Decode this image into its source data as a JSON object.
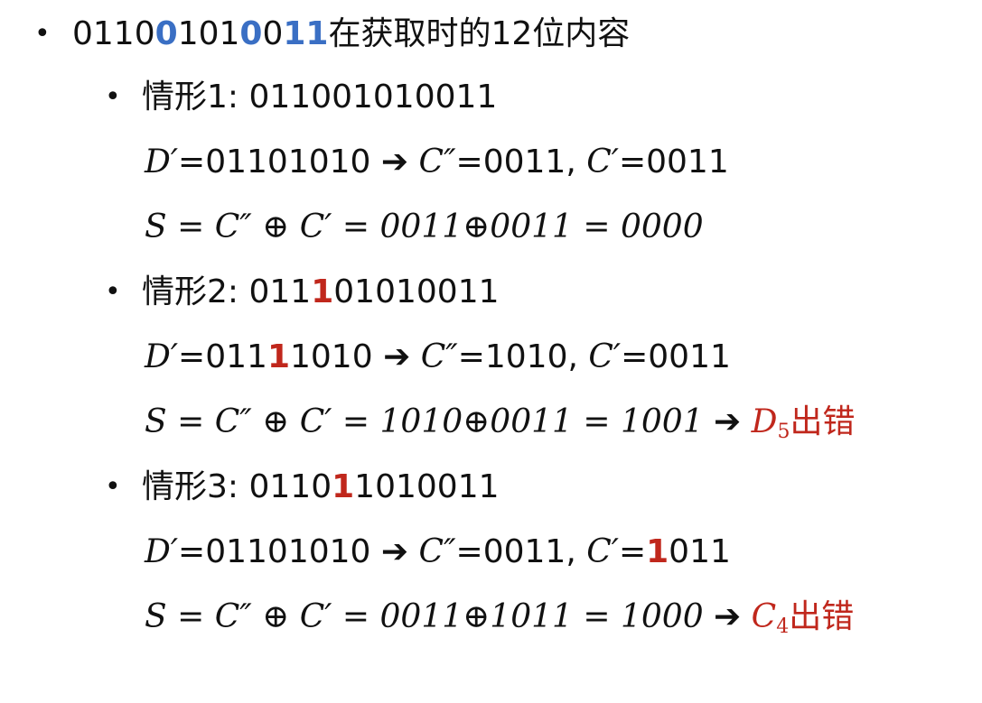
{
  "bullet_glyph": "•",
  "arrow_glyph": "➔",
  "header": {
    "p0": "0110",
    "h0": "0",
    "p1": "101",
    "h1": "0",
    "p2": "0",
    "h2": "11",
    "suffix": "在获取时的12位内容"
  },
  "cases": [
    {
      "title": "情形1: 011001010011",
      "d_label": "D′",
      "d_value": "=01101010",
      "c2_label": "C″",
      "c2_value": "=0011,",
      "c1_label": "C′",
      "c1_value": "=0011",
      "s_expr": "S = C″ ⊕ C′ = 0011⊕0011 = 0000"
    },
    {
      "title_a": "情形2: 011",
      "title_h": "1",
      "title_b": "01010011",
      "d_label": "D′",
      "d_a": "=011",
      "d_h": "1",
      "d_b": "1010",
      "c2_label": "C″",
      "c2_value": "=1010,",
      "c1_label": "C′",
      "c1_value": "=0011",
      "s_expr": "S = C″ ⊕ C′ = 1010⊕0011 = 1001",
      "result_var": "D",
      "result_sub": "5",
      "result_text": "出错"
    },
    {
      "title_a": "情形3: 0110",
      "title_h": "1",
      "title_b": "1010011",
      "d_label": "D′",
      "d_value": "=01101010",
      "c2_label": "C″",
      "c2_value": "=0011,",
      "c1_label": "C′",
      "c1_a": "=",
      "c1_h": "1",
      "c1_b": "011",
      "s_expr": "S = C″ ⊕ C′ = 0011⊕1011 = 1000",
      "result_var": "C",
      "result_sub": "4",
      "result_text": "出错"
    }
  ]
}
